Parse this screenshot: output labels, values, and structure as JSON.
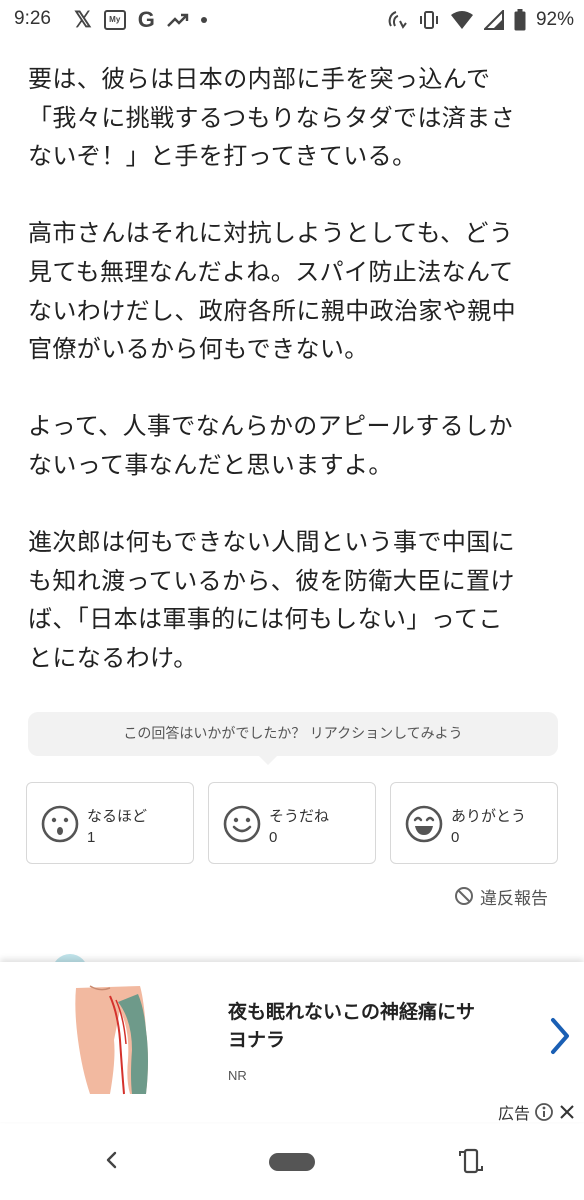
{
  "status_bar": {
    "time": "9:26",
    "left_icons": [
      "x-icon",
      "my-icon",
      "google-icon",
      "trend-icon",
      "dot-icon"
    ],
    "my_label": "My",
    "g_label": "G",
    "battery": "92%",
    "right_icons": [
      "nfc-icon",
      "vibrate-icon",
      "wifi-icon",
      "signal-icon",
      "battery-icon"
    ]
  },
  "article": {
    "paragraphs": [
      [
        "要は、彼らは日本の内部に手を突っ込んで",
        "「我々に挑戦するつもりならタダでは済まさ",
        "ないぞ！」と手を打ってきている。"
      ],
      [
        "高市さんはそれに対抗しようとしても、どう",
        "見ても無理なんだよね。スパイ防止法なんて",
        "ないわけだし、政府各所に親中政治家や親中",
        "官僚がいるから何もできない。"
      ],
      [
        "よって、人事でなんらかのアピールするしか",
        "ないって事なんだと思いますよ。"
      ],
      [
        "進次郎は何もできない人間という事で中国に",
        "も知れ渡っているから、彼を防衛大臣に置け",
        "ば、「日本は軍事的には何もしない」ってこ",
        "とになるわけ。"
      ]
    ]
  },
  "reaction_prompt": "この回答はいかがでしたか？ リアクションしてみよう",
  "reactions": [
    {
      "label": "なるほど",
      "count": "1",
      "icon": "surprised-face-icon"
    },
    {
      "label": "そうだね",
      "count": "0",
      "icon": "smile-face-icon"
    },
    {
      "label": "ありがとう",
      "count": "0",
      "icon": "grin-face-icon"
    }
  ],
  "report": {
    "label": "違反報告",
    "icon": "prohibited-icon"
  },
  "ad": {
    "title_lines": [
      "夜も眠れないこの神経痛にサ",
      "ヨナラ"
    ],
    "source": "NR",
    "footer_label": "広告",
    "colors": {
      "chevron": "#1a5fb4",
      "skin": "#f2b9a0",
      "highlight": "#6e9a8a",
      "nerve": "#d4322c"
    }
  },
  "nav": {
    "icons": [
      "back-icon",
      "home-pill",
      "rotate-icon"
    ]
  }
}
